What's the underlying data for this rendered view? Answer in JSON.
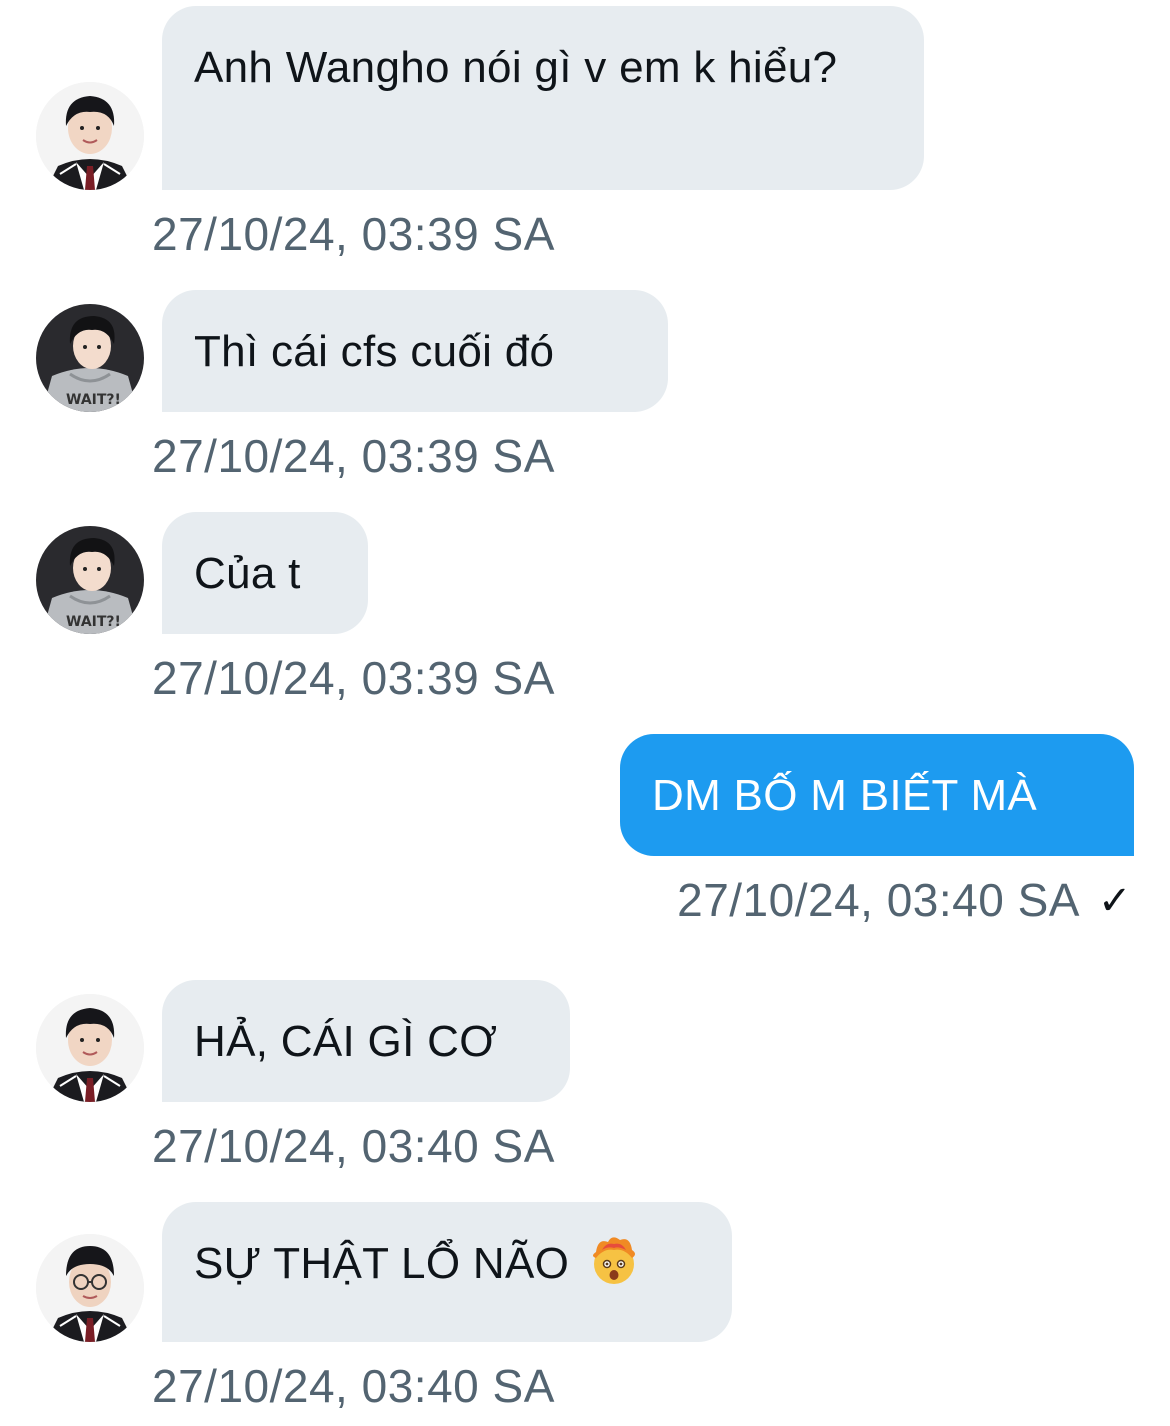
{
  "conversation": {
    "messages": [
      {
        "direction": "in",
        "avatar": "avatar-boy-school-uniform",
        "text": "Anh Wangho nói gì v em k hiểu?",
        "time": "27/10/24, 03:39 SA"
      },
      {
        "direction": "in",
        "avatar": "avatar-boy-grey-hoodie",
        "text": "Thì cái cfs cuối đó",
        "time": "27/10/24, 03:39 SA"
      },
      {
        "direction": "in",
        "avatar": "avatar-boy-grey-hoodie",
        "text": "Của t",
        "time": "27/10/24, 03:39 SA"
      },
      {
        "direction": "out",
        "text": "DM BỐ M BIẾT MÀ",
        "time": "27/10/24, 03:40 SA",
        "status_icon": "checkmark-icon",
        "status_glyph": "✓"
      },
      {
        "direction": "in",
        "avatar": "avatar-boy-school-uniform",
        "text": "HẢ, CÁI GÌ CƠ",
        "time": "27/10/24, 03:40 SA"
      },
      {
        "direction": "in",
        "avatar": "avatar-boy-glasses-uniform",
        "text": "SỰ THẬT LỔ NÃO",
        "emoji": "exploding-head-emoji",
        "time": "27/10/24, 03:40 SA"
      }
    ]
  },
  "colors": {
    "incoming_bubble": "#e7ecf0",
    "outgoing_bubble": "#1d9bf0",
    "timestamp": "#536471",
    "text": "#0f1419"
  }
}
